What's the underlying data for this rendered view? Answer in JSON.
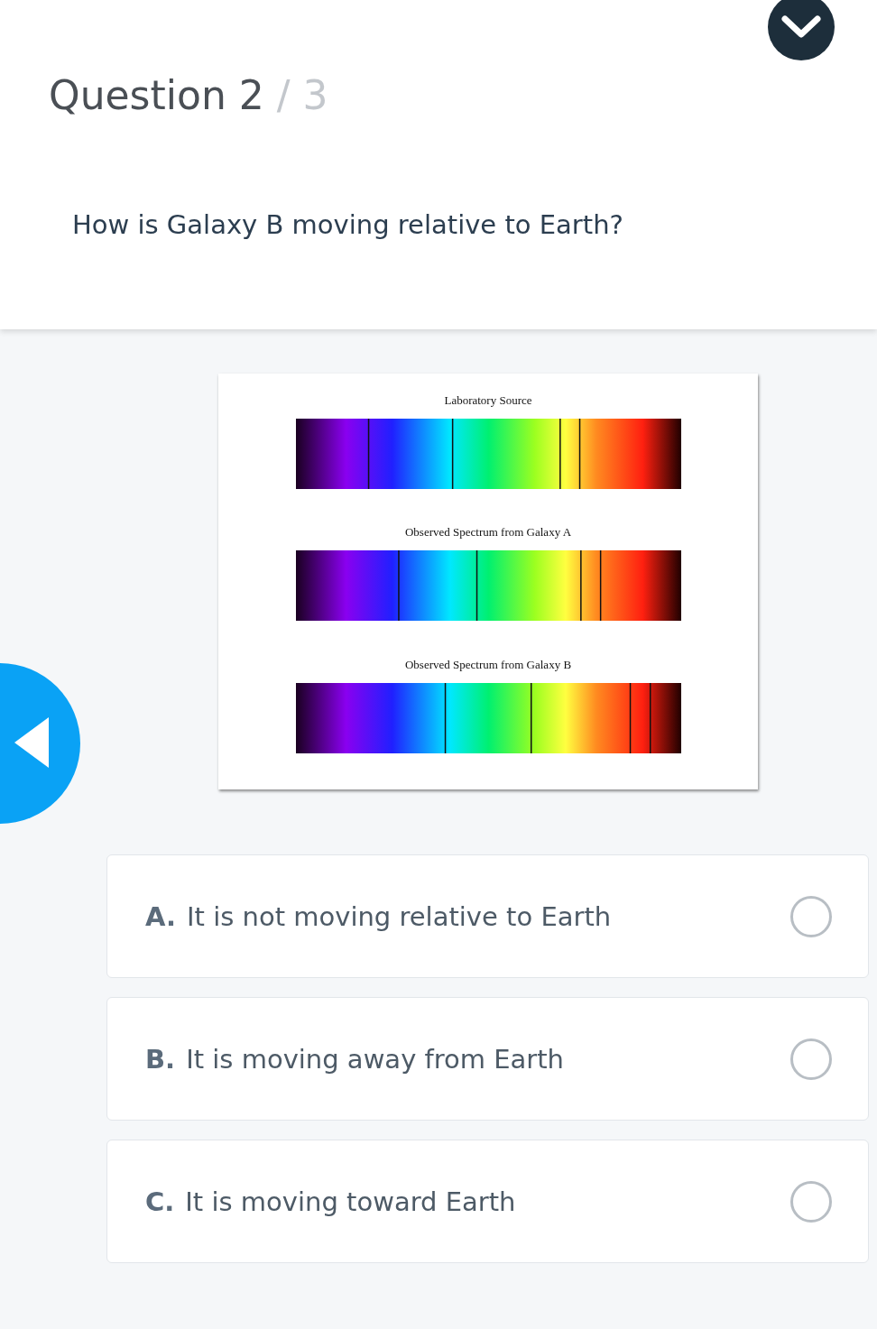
{
  "header": {
    "question_label": "Question 2",
    "total": "/ 3",
    "question": "How is Galaxy B moving relative to Earth?"
  },
  "figure": {
    "panels": [
      {
        "title": "Laboratory Source"
      },
      {
        "title": "Observed Spectrum from Galaxy A"
      },
      {
        "title": "Observed Spectrum from Galaxy B"
      }
    ]
  },
  "options": [
    {
      "letter": "A.",
      "text": "It is not moving relative to Earth",
      "selected": false
    },
    {
      "letter": "B.",
      "text": "It is moving away from Earth",
      "selected": false
    },
    {
      "letter": "C.",
      "text": "It is moving toward Earth",
      "selected": false
    }
  ]
}
